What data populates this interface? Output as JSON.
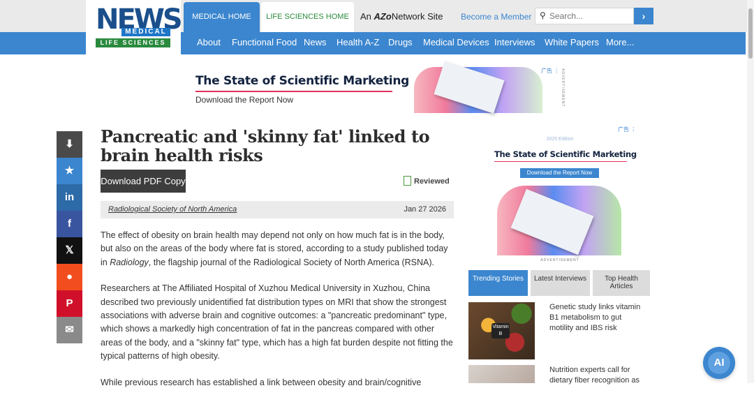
{
  "header": {
    "logo": {
      "news": "NEWS",
      "medical": "MEDICAL",
      "life_sciences": "LIFE SCIENCES"
    },
    "tabs": [
      "MEDICAL HOME",
      "LIFE SCIENCES HOME"
    ],
    "azo_prefix": "An",
    "azo_brand": "AZo",
    "azo_suffix": "Network Site",
    "become_member": "Become a Member",
    "search": {
      "placeholder": "Search...",
      "button": "›",
      "icon": "search-icon"
    }
  },
  "nav": [
    "About",
    "Functional Food",
    "News",
    "Health A-Z",
    "Drugs",
    "Medical Devices",
    "Interviews",
    "White Papers",
    "More..."
  ],
  "top_ad": {
    "headline": "The State of Scientific Marketing",
    "subline": "Download the Report Now",
    "label": "广告 ⋮",
    "vertical_label": "ADVERTISEMENT"
  },
  "share": [
    {
      "name": "download-icon",
      "glyph": "⬇",
      "color": "#4a4a4a"
    },
    {
      "name": "star-icon",
      "glyph": "★",
      "color": "#3b86cf"
    },
    {
      "name": "linkedin-icon",
      "glyph": "in",
      "color": "#2d6aa8"
    },
    {
      "name": "facebook-icon",
      "glyph": "f",
      "color": "#3a559f"
    },
    {
      "name": "x-icon",
      "glyph": "𝕏",
      "color": "#111111"
    },
    {
      "name": "reddit-icon",
      "glyph": "●",
      "color": "#f24d1f"
    },
    {
      "name": "pinterest-icon",
      "glyph": "P",
      "color": "#d0102a"
    },
    {
      "name": "email-icon",
      "glyph": "✉",
      "color": "#8a8a8a"
    }
  ],
  "article": {
    "title": "Pancreatic and 'skinny fat' linked to brain health risks",
    "download_pdf": "Download PDF Copy",
    "reviewed": "Reviewed",
    "source": "Radiological Society of North America",
    "date": "Jan 27 2026",
    "p1_a": "The effect of obesity on brain health may depend not only on how much fat is in the body, but also on the areas of the body where fat is stored, according to a study published today in ",
    "p1_em": "Radiology",
    "p1_b": ", the flagship journal of the Radiological Society of North America (RSNA).",
    "p2": "Researchers at The Affiliated Hospital of Xuzhou Medical University in Xuzhou, China described two previously unidentified fat distribution types on MRI that show the strongest associations with adverse brain and cognitive outcomes: a \"pancreatic predominant\" type, which shows a markedly high concentration of fat in the pancreas compared with other areas of the body, and a \"skinny fat\" type, which has a high fat burden despite not fitting the typical patterns of high obesity.",
    "p3": "While previous research has established a link between obesity and brain/cognitive"
  },
  "side_ad": {
    "label": "广告 ⋮",
    "edition": "2025 Edition",
    "headline": "The State of Scientific Marketing",
    "download": "Download the Report Now",
    "advertisement": "ADVERTISEMENT"
  },
  "side_tabs": [
    "Trending Stories",
    "Latest Interviews",
    "Top Health Articles"
  ],
  "side_list": [
    "Genetic study links vitamin B1 metabolism to gut motility and IBS risk",
    "Nutrition experts call for dietary fiber recognition as"
  ],
  "ai_button": "AI",
  "colors": {
    "accent": "#3b86cf",
    "green": "#2a8a3e",
    "navy": "#1a4f8b"
  }
}
